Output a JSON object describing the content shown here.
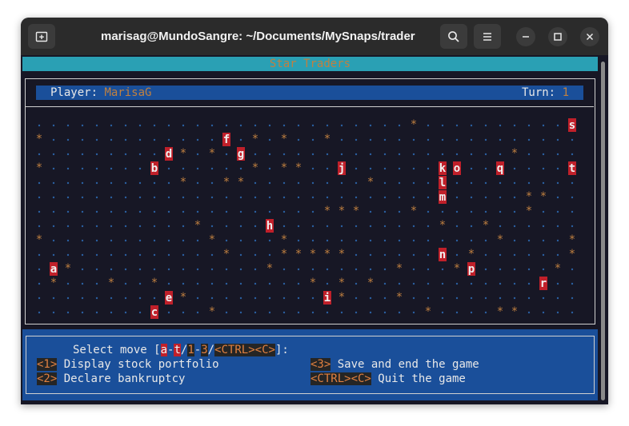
{
  "window": {
    "title": "marisag@MundoSangre: ~/Documents/MySnaps/trader"
  },
  "header": {
    "game_title": "Star Traders",
    "player_label": "Player:",
    "player_name": "MarisaG",
    "turn_label": "Turn:",
    "turn_value": "1"
  },
  "map": {
    "stars": [
      [
        15,
        1
      ],
      [
        26,
        0
      ],
      [
        37,
        0
      ],
      [
        0,
        1
      ],
      [
        17,
        1
      ],
      [
        20,
        1
      ],
      [
        33,
        2
      ],
      [
        10,
        2
      ],
      [
        12,
        2
      ],
      [
        0,
        3
      ],
      [
        15,
        3
      ],
      [
        17,
        3
      ],
      [
        18,
        3
      ],
      [
        10,
        4
      ],
      [
        13,
        4
      ],
      [
        14,
        4
      ],
      [
        23,
        4
      ],
      [
        34,
        5
      ],
      [
        35,
        5
      ],
      [
        20,
        6
      ],
      [
        21,
        6
      ],
      [
        22,
        6
      ],
      [
        26,
        6
      ],
      [
        34,
        6
      ],
      [
        11,
        7
      ],
      [
        28,
        7
      ],
      [
        31,
        7
      ],
      [
        0,
        8
      ],
      [
        12,
        8
      ],
      [
        17,
        8
      ],
      [
        32,
        8
      ],
      [
        37,
        8
      ],
      [
        13,
        9
      ],
      [
        17,
        9
      ],
      [
        18,
        9
      ],
      [
        19,
        9
      ],
      [
        20,
        9
      ],
      [
        21,
        9
      ],
      [
        30,
        9
      ],
      [
        37,
        9
      ],
      [
        2,
        10
      ],
      [
        16,
        10
      ],
      [
        25,
        10
      ],
      [
        29,
        10
      ],
      [
        36,
        10
      ],
      [
        1,
        11
      ],
      [
        5,
        11
      ],
      [
        8,
        11
      ],
      [
        19,
        11
      ],
      [
        21,
        11
      ],
      [
        23,
        11
      ],
      [
        10,
        12
      ],
      [
        21,
        12
      ],
      [
        25,
        12
      ],
      [
        12,
        13
      ],
      [
        27,
        13
      ],
      [
        32,
        13
      ],
      [
        33,
        13
      ]
    ],
    "companies": [
      {
        "letter": "s",
        "col": 37,
        "row": 0
      },
      {
        "letter": "f",
        "col": 13,
        "row": 1
      },
      {
        "letter": "d",
        "col": 9,
        "row": 2
      },
      {
        "letter": "g",
        "col": 14,
        "row": 2
      },
      {
        "letter": "b",
        "col": 8,
        "row": 3
      },
      {
        "letter": "j",
        "col": 21,
        "row": 3
      },
      {
        "letter": "k",
        "col": 28,
        "row": 3
      },
      {
        "letter": "o",
        "col": 29,
        "row": 3
      },
      {
        "letter": "q",
        "col": 32,
        "row": 3
      },
      {
        "letter": "t",
        "col": 37,
        "row": 3
      },
      {
        "letter": "l",
        "col": 28,
        "row": 4
      },
      {
        "letter": "m",
        "col": 28,
        "row": 5
      },
      {
        "letter": "h",
        "col": 16,
        "row": 7
      },
      {
        "letter": "n",
        "col": 28,
        "row": 9
      },
      {
        "letter": "a",
        "col": 1,
        "row": 10
      },
      {
        "letter": "p",
        "col": 30,
        "row": 10
      },
      {
        "letter": "r",
        "col": 35,
        "row": 11
      },
      {
        "letter": "e",
        "col": 9,
        "row": 12
      },
      {
        "letter": "i",
        "col": 20,
        "row": 12
      },
      {
        "letter": "c",
        "col": 8,
        "row": 13
      }
    ]
  },
  "commands": {
    "select_prefix": "Select move [",
    "key_a": "a",
    "dash": "-",
    "key_t": "t",
    "slash": "/",
    "key_1": "1",
    "key_3": "3",
    "key_ctrl_c": "<CTRL><C>",
    "select_suffix": "]:",
    "key1": "<1>",
    "label1": " Display stock portfolio",
    "key2": "<2>",
    "label2": " Declare bankruptcy",
    "key3": "<3>",
    "label3": " Save and end the game",
    "keyq": "<CTRL><C>",
    "labelq": " Quit the game"
  },
  "colors": {
    "star": "#c08040",
    "dot": "#2a5fa0",
    "company_bg": "#c0202a",
    "company_fg": "#f0f0f0",
    "panel": "#1a4f9a"
  }
}
